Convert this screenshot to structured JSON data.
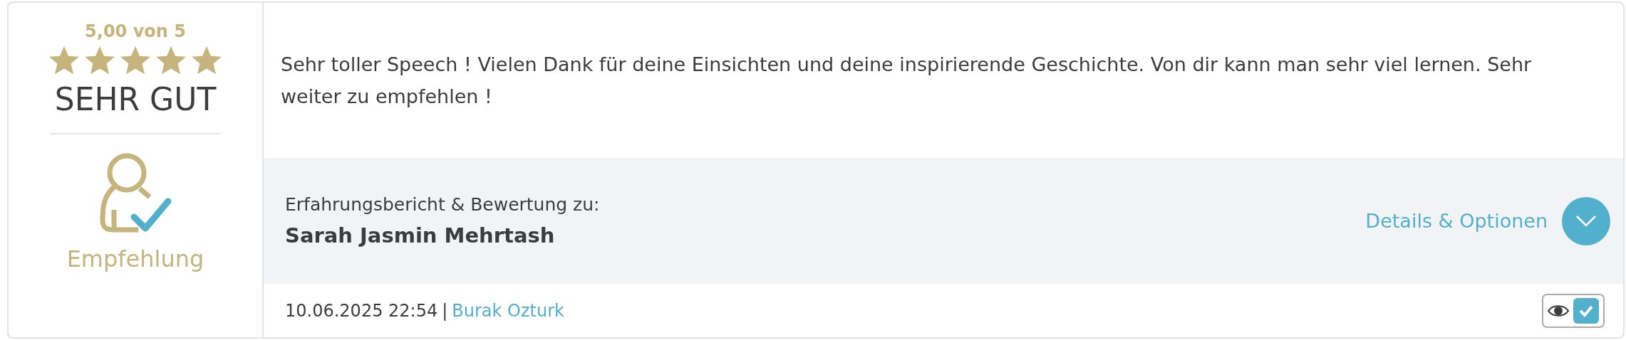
{
  "rating": {
    "score": "5,00 von 5",
    "stars": 5,
    "verdict": "SEHR GUT",
    "recommendation": "Empfehlung"
  },
  "review": {
    "text": "Sehr toller Speech ! Vielen Dank für deine Einsichten und deine inspirierende Geschichte. Von dir kann man sehr viel lernen. Sehr weiter zu empfehlen !"
  },
  "subject": {
    "label": "Erfahrungsbericht & Bewertung zu:",
    "name": "Sarah Jasmin Mehrtash",
    "details_link": "Details & Optionen"
  },
  "footer": {
    "date": "10.06.2025 22:54",
    "separator": "|",
    "author": "Burak Ozturk",
    "approved": true
  }
}
